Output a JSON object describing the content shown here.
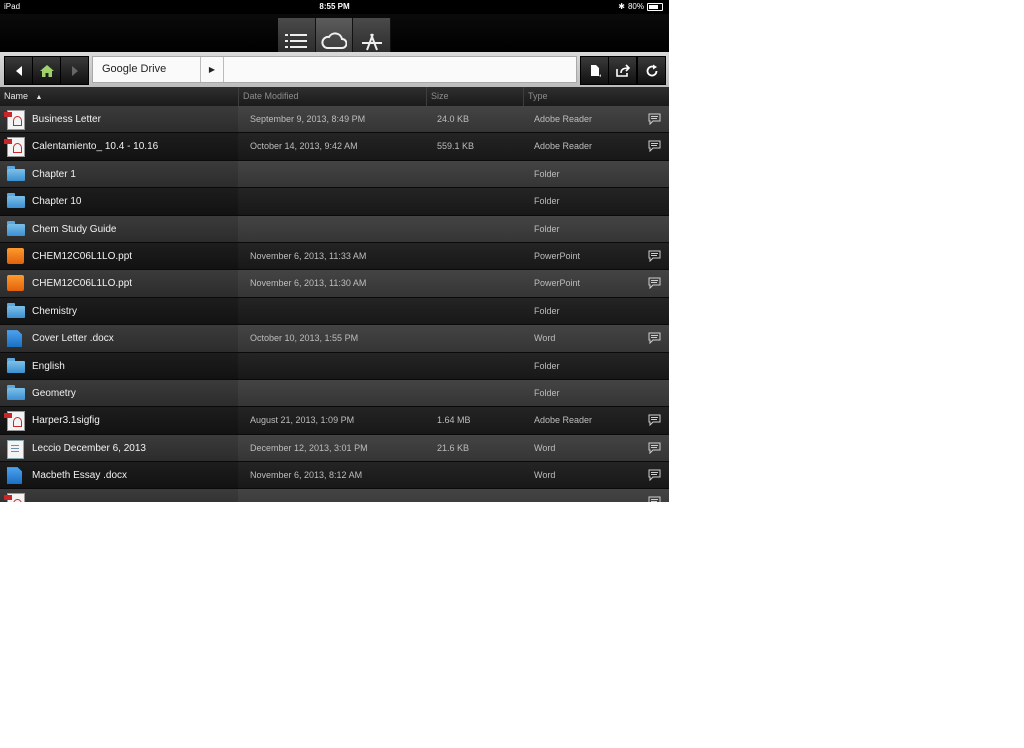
{
  "status": {
    "device": "iPad",
    "time": "8:55 PM",
    "battery": "80%"
  },
  "modes": [
    {
      "name": "list-view-tab",
      "icon": "list-icon"
    },
    {
      "name": "cloud-tab",
      "icon": "cloud-icon",
      "active": true
    },
    {
      "name": "app-store-tab",
      "icon": "app-store-icon"
    }
  ],
  "nav": {
    "location": "Google Drive"
  },
  "columns": {
    "name": "Name",
    "sort_indicator": "▲",
    "date": "Date Modified",
    "size": "Size",
    "type": "Type"
  },
  "files": [
    {
      "name": "Business Letter",
      "date": "September 9, 2013, 8:49 PM",
      "size": "24.0 KB",
      "type": "Adobe Reader",
      "icon": "pdf-icon",
      "comment": true
    },
    {
      "name": "Calentamiento_ 10.4 - 10.16",
      "date": "October 14, 2013, 9:42 AM",
      "size": "559.1 KB",
      "type": "Adobe Reader",
      "icon": "pdf-icon",
      "comment": true
    },
    {
      "name": "Chapter 1",
      "date": "",
      "size": "",
      "type": "Folder",
      "icon": "folder-icon",
      "comment": false
    },
    {
      "name": "Chapter 10",
      "date": "",
      "size": "",
      "type": "Folder",
      "icon": "folder-icon",
      "comment": false
    },
    {
      "name": "Chem Study Guide",
      "date": "",
      "size": "",
      "type": "Folder",
      "icon": "folder-icon",
      "comment": false
    },
    {
      "name": "CHEM12C06L1LO.ppt",
      "date": "November 6, 2013, 11:33 AM",
      "size": "",
      "type": "PowerPoint",
      "icon": "powerpoint-icon",
      "comment": true
    },
    {
      "name": "CHEM12C06L1LO.ppt",
      "date": "November 6, 2013, 11:30 AM",
      "size": "",
      "type": "PowerPoint",
      "icon": "powerpoint-icon",
      "comment": true
    },
    {
      "name": "Chemistry",
      "date": "",
      "size": "",
      "type": "Folder",
      "icon": "folder-icon",
      "comment": false
    },
    {
      "name": "Cover Letter .docx",
      "date": "October 10, 2013, 1:55 PM",
      "size": "",
      "type": "Word",
      "icon": "word-icon",
      "comment": true
    },
    {
      "name": "English",
      "date": "",
      "size": "",
      "type": "Folder",
      "icon": "folder-icon",
      "comment": false
    },
    {
      "name": "Geometry",
      "date": "",
      "size": "",
      "type": "Folder",
      "icon": "folder-icon",
      "comment": false
    },
    {
      "name": "Harper3.1sigfig",
      "date": "August 21, 2013, 1:09 PM",
      "size": "1.64 MB",
      "type": "Adobe Reader",
      "icon": "pdf-icon",
      "comment": true
    },
    {
      "name": "Leccio December 6, 2013",
      "date": "December 12, 2013, 3:01 PM",
      "size": "21.6 KB",
      "type": "Word",
      "icon": "document-icon",
      "comment": true
    },
    {
      "name": "Macbeth Essay .docx",
      "date": "November 6, 2013, 8:12 AM",
      "size": "",
      "type": "Word",
      "icon": "word-icon",
      "comment": true
    },
    {
      "name": "",
      "date": "",
      "size": "",
      "type": "",
      "icon": "pdf-icon",
      "comment": true
    }
  ]
}
